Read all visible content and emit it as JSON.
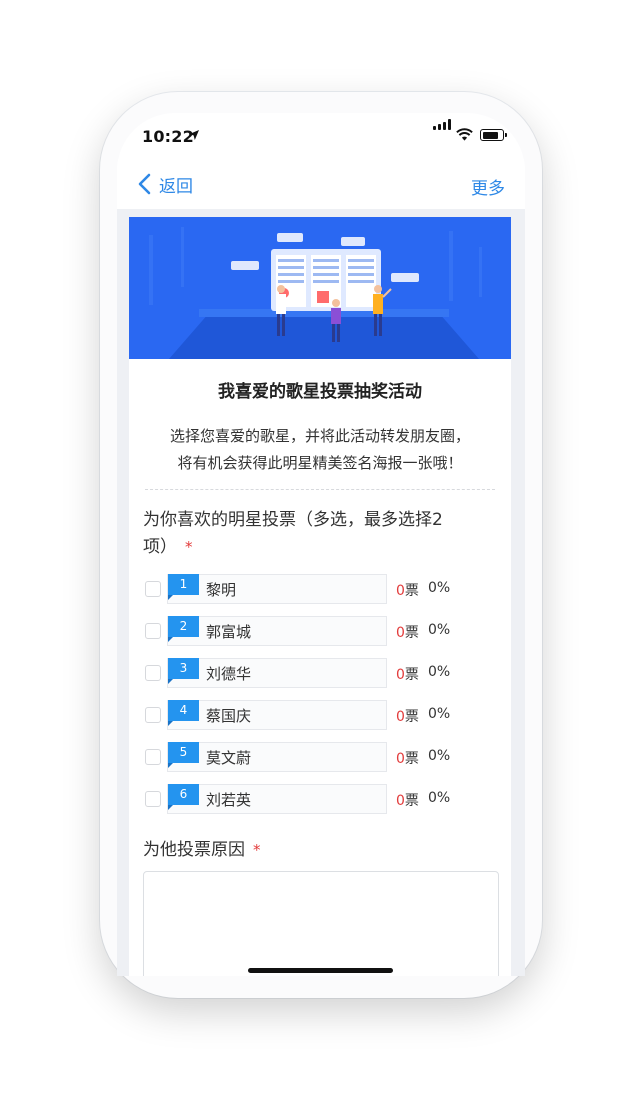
{
  "status_bar": {
    "time": "10:22"
  },
  "nav": {
    "back_label": "返回",
    "more_label": "更多"
  },
  "survey": {
    "title": "我喜爱的歌星投票抽奖活动",
    "description_line1": "选择您喜爱的歌星，并将此活动转发朋友圈，",
    "description_line2": "将有机会获得此明星精美签名海报一张哦！"
  },
  "question1": {
    "text_line1": "为你喜欢的明星投票（多选，最多选择2",
    "text_line2": "项）",
    "required_mark": "*",
    "vote_unit": "票",
    "options": [
      {
        "num": "1",
        "name": "黎明",
        "votes": "0",
        "percent": "0%"
      },
      {
        "num": "2",
        "name": "郭富城",
        "votes": "0",
        "percent": "0%"
      },
      {
        "num": "3",
        "name": "刘德华",
        "votes": "0",
        "percent": "0%"
      },
      {
        "num": "4",
        "name": "蔡国庆",
        "votes": "0",
        "percent": "0%"
      },
      {
        "num": "5",
        "name": "莫文蔚",
        "votes": "0",
        "percent": "0%"
      },
      {
        "num": "6",
        "name": "刘若英",
        "votes": "0",
        "percent": "0%"
      }
    ]
  },
  "question2": {
    "text": "为他投票原因",
    "required_mark": "*",
    "value": ""
  },
  "colors": {
    "accent": "#2e88e6",
    "badge": "#2494ef",
    "required": "#e23b3b",
    "banner": "#2a68f2"
  }
}
